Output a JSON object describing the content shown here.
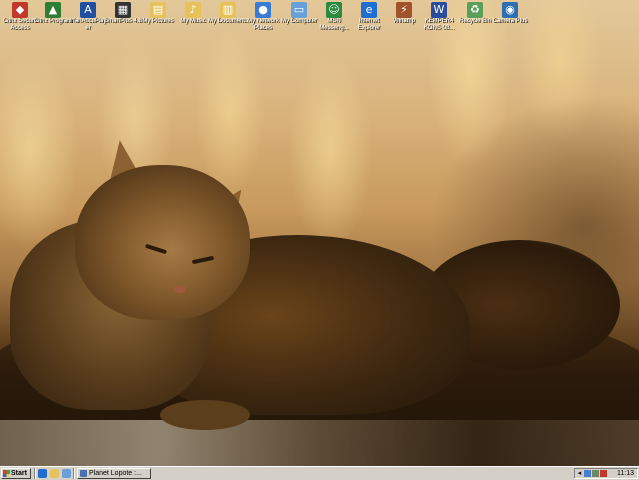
{
  "desktop": {
    "icons": [
      {
        "label": "Citrix Secure Access",
        "icon": "citrix-icon",
        "color": "#c0392b"
      },
      {
        "label": "Citrix Program",
        "icon": "citrix-program-icon",
        "color": "#2e7d32"
      },
      {
        "label": "IrfanAccuPlayer",
        "icon": "player-icon",
        "color": "#1e4fa0"
      },
      {
        "label": "SmartPlus 4.8",
        "icon": "calculator-icon",
        "color": "#333333"
      },
      {
        "label": "My Pictures",
        "icon": "pictures-folder-icon",
        "color": "#e6c35a"
      },
      {
        "label": "My Music",
        "icon": "music-folder-icon",
        "color": "#e6c35a"
      },
      {
        "label": "My Documents",
        "icon": "documents-folder-icon",
        "color": "#e6c35a"
      },
      {
        "label": "My Network Places",
        "icon": "network-icon",
        "color": "#3a7bd5"
      },
      {
        "label": "My Computer",
        "icon": "computer-icon",
        "color": "#6aa0d8"
      },
      {
        "label": "MSN Messeng...",
        "icon": "messenger-icon",
        "color": "#2b8a3e"
      },
      {
        "label": "Internet Explorer",
        "icon": "ie-icon",
        "color": "#1e6fd0"
      },
      {
        "label": "Winamp",
        "icon": "winamp-icon",
        "color": "#a0522d"
      },
      {
        "label": "KEMPER4 KONS 08...",
        "icon": "document-icon",
        "color": "#2a4d9b"
      },
      {
        "label": "Recycle Bin",
        "icon": "recycle-bin-icon",
        "color": "#5a9f5a"
      },
      {
        "label": "Camera Plus",
        "icon": "camera-icon",
        "color": "#2f6fb0"
      }
    ]
  },
  "taskbar": {
    "start_label": "Start",
    "task_label": "Planet Lopote :...",
    "clock": "11:13",
    "quick_launch": [
      "ie-quicklaunch-icon",
      "folder-quicklaunch-icon",
      "desktop-quicklaunch-icon"
    ],
    "tray_icons": [
      "arrow-tray-icon",
      "network-tray-icon",
      "speaker-tray-icon",
      "security-tray-icon"
    ]
  }
}
